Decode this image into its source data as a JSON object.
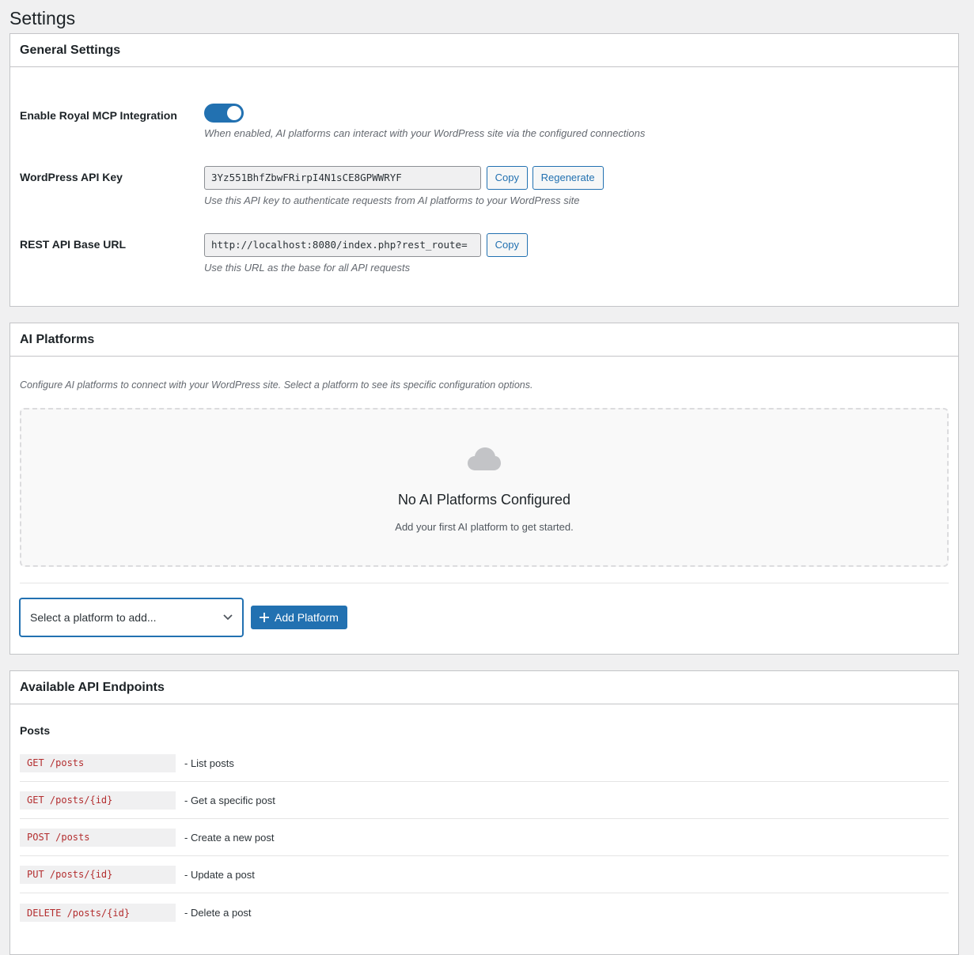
{
  "page": {
    "title": "Settings"
  },
  "general": {
    "header": "General Settings",
    "enable": {
      "label": "Enable Royal MCP Integration",
      "enabled": true,
      "description": "When enabled, AI platforms can interact with your WordPress site via the configured connections"
    },
    "api_key": {
      "label": "WordPress API Key",
      "value": "3Yz551BhfZbwFRirpI4N1sCE8GPWWRYF",
      "copy_label": "Copy",
      "regenerate_label": "Regenerate",
      "description": "Use this API key to authenticate requests from AI platforms to your WordPress site"
    },
    "base_url": {
      "label": "REST API Base URL",
      "value": "http://localhost:8080/index.php?rest_route=",
      "copy_label": "Copy",
      "description": "Use this URL as the base for all API requests"
    }
  },
  "platforms": {
    "header": "AI Platforms",
    "intro": "Configure AI platforms to connect with your WordPress site. Select a platform to see its specific configuration options.",
    "empty_title": "No AI Platforms Configured",
    "empty_subtitle": "Add your first AI platform to get started.",
    "select_placeholder": "Select a platform to add...",
    "add_button_label": "Add Platform"
  },
  "endpoints": {
    "header": "Available API Endpoints",
    "group_title": "Posts",
    "items": [
      {
        "code": "GET /posts",
        "description": "- List posts"
      },
      {
        "code": "GET /posts/{id}",
        "description": "- Get a specific post"
      },
      {
        "code": "POST /posts",
        "description": "- Create a new post"
      },
      {
        "code": "PUT /posts/{id}",
        "description": "- Update a post"
      },
      {
        "code": "DELETE /posts/{id}",
        "description": "- Delete a post"
      }
    ]
  },
  "colors": {
    "accent": "#2271b1",
    "code_text": "#b32d2e",
    "background": "#f0f0f1"
  }
}
